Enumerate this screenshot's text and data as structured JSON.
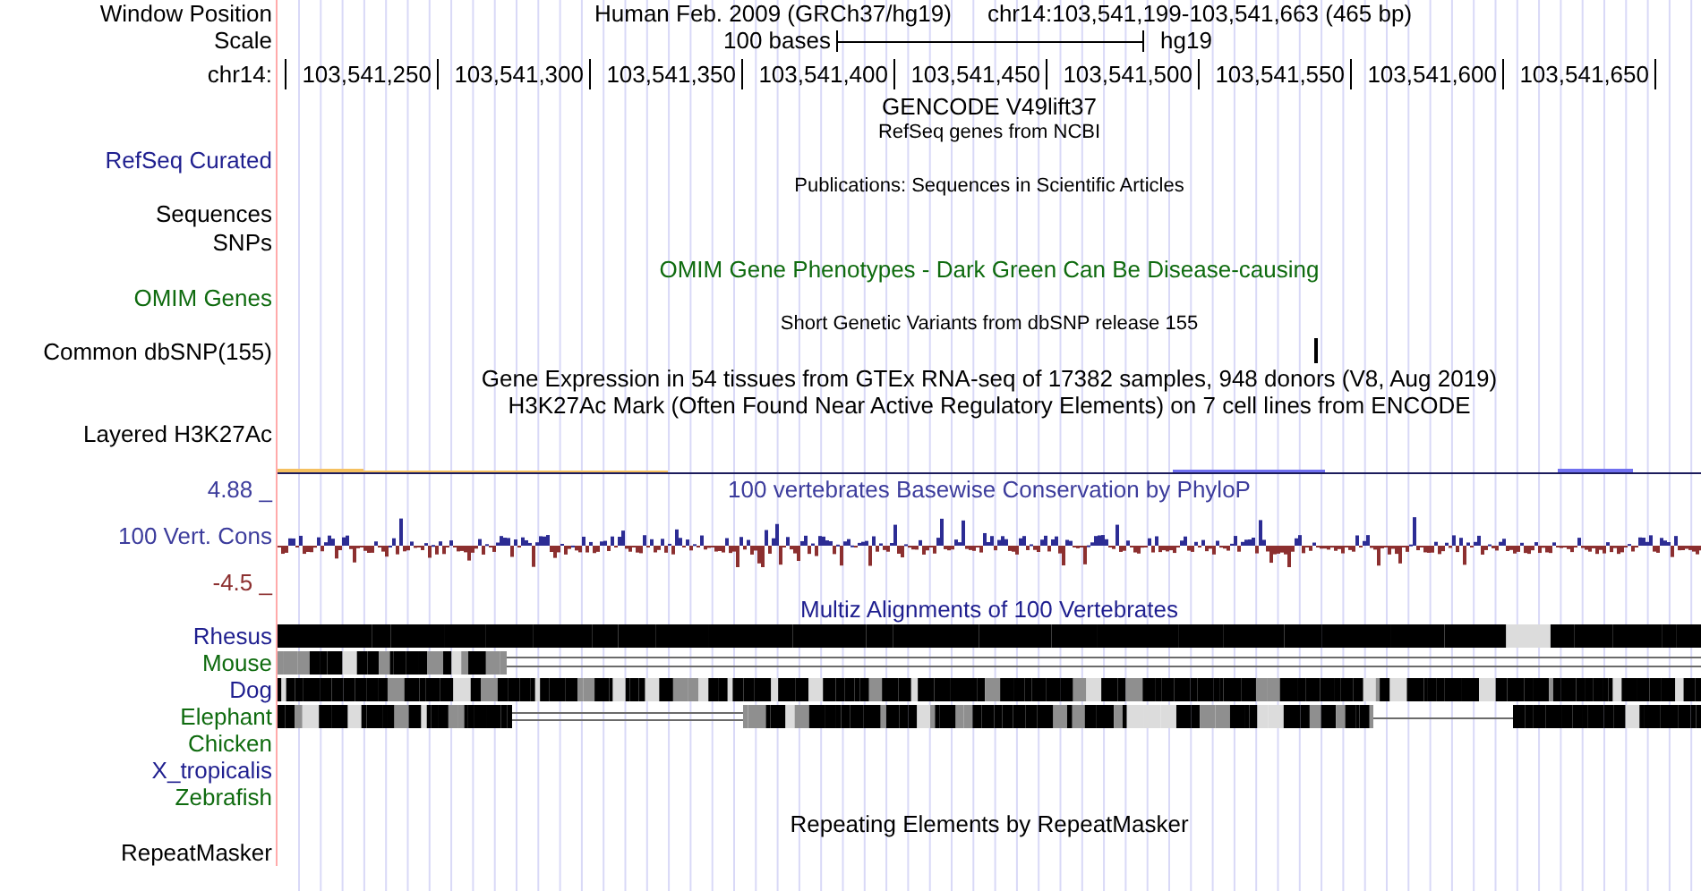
{
  "rows": [
    {
      "kind": "position",
      "label": "Window Position",
      "title": "Human Feb. 2009 (GRCh37/hg19)",
      "position": "chr14:103,541,199-103,541,663 (465 bp)"
    },
    {
      "kind": "scale",
      "label": "Scale",
      "length": "100 bases",
      "assembly": "hg19"
    },
    {
      "kind": "ruler",
      "label": "chr14:",
      "ticks": [
        "103,541,250",
        "103,541,300",
        "103,541,350",
        "103,541,400",
        "103,541,450",
        "103,541,500",
        "103,541,550",
        "103,541,600",
        "103,541,650"
      ]
    },
    {
      "kind": "caption",
      "caption": "GENCODE V49lift37",
      "color": "#000000"
    },
    {
      "kind": "note",
      "caption": "RefSeq genes from NCBI"
    },
    {
      "kind": "track",
      "label": "RefSeq Curated",
      "color": "#1f1f8f"
    },
    {
      "kind": "note",
      "caption": "Publications: Sequences in Scientific Articles"
    },
    {
      "kind": "track",
      "label": "Sequences",
      "color": "#000000"
    },
    {
      "kind": "track",
      "label": "SNPs",
      "color": "#000000"
    },
    {
      "kind": "caption",
      "caption": "OMIM Gene Phenotypes - Dark Green Can Be Disease-causing",
      "color": "#0f6b0f"
    },
    {
      "kind": "track",
      "label": "OMIM Genes",
      "color": "#0f6b0f"
    },
    {
      "kind": "note",
      "caption": "Short Genetic Variants from dbSNP release 155"
    },
    {
      "kind": "variants",
      "label": "Common dbSNP(155)",
      "color": "#000000"
    },
    {
      "kind": "caption",
      "caption": "Gene Expression in 54 tissues from GTEx RNA-seq of 17382 samples, 948 donors (V8, Aug 2019)",
      "color": "#000000"
    },
    {
      "kind": "caption",
      "caption": "H3K27Ac Mark (Often Found Near Active Regulatory Elements) on 7 cell lines from ENCODE",
      "color": "#000000"
    },
    {
      "kind": "track",
      "label": "Layered H3K27Ac",
      "color": "#000000"
    },
    {
      "kind": "signal"
    },
    {
      "kind": "caption",
      "label": "4.88 _",
      "caption": "100 vertebrates Basewise Conservation by PhyloP",
      "color": "#3c3c9c"
    },
    {
      "kind": "wiggle",
      "label": "100 Vert. Cons",
      "color": "#3c3c9c"
    },
    {
      "kind": "track",
      "label": "-4.5 _",
      "color": "#8c2f2f"
    },
    {
      "kind": "caption",
      "caption": "Multiz Alignments of 100 Vertebrates",
      "color": "#1f1f8f"
    },
    {
      "kind": "alignment",
      "label": "Rhesus",
      "color": "#1f1f8f",
      "aligned": true
    },
    {
      "kind": "alignment",
      "label": "Mouse",
      "color": "#0f6b0f",
      "aligned": true
    },
    {
      "kind": "alignment",
      "label": "Dog",
      "color": "#1f1f8f",
      "aligned": true
    },
    {
      "kind": "alignment",
      "label": "Elephant",
      "color": "#0f6b0f",
      "aligned": true
    },
    {
      "kind": "alignment",
      "label": "Chicken",
      "color": "#0f6b0f",
      "aligned": false
    },
    {
      "kind": "alignment",
      "label": "X_tropicalis",
      "color": "#1f1f8f",
      "aligned": false
    },
    {
      "kind": "alignment",
      "label": "Zebrafish",
      "color": "#0f6b0f",
      "aligned": false
    },
    {
      "kind": "caption",
      "caption": "Repeating Elements by RepeatMasker",
      "color": "#000000"
    },
    {
      "kind": "track",
      "label": "RepeatMasker",
      "color": "#000000"
    }
  ]
}
